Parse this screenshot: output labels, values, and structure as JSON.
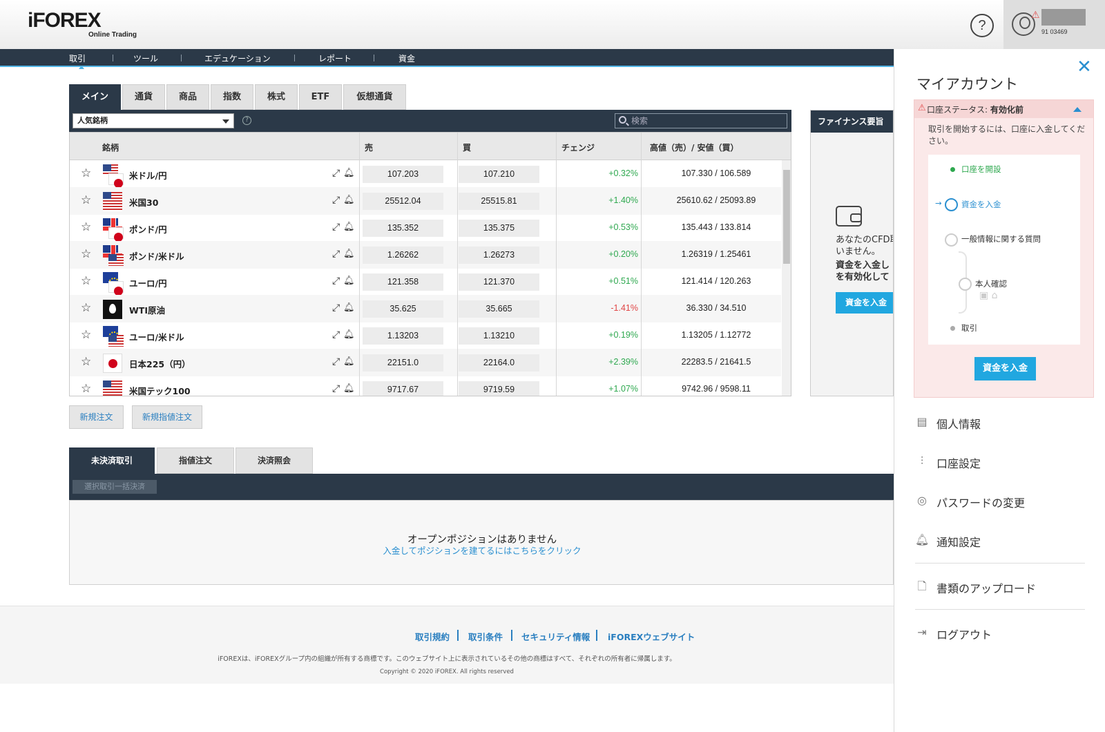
{
  "brand": {
    "name": "iFOREX",
    "tagline": "Online Trading"
  },
  "header": {
    "help_icon": "question-bubble-icon",
    "user_id": "91 03469"
  },
  "nav": [
    "取引",
    "ツール",
    "エデュケーション",
    "レポート",
    "資金"
  ],
  "asset_tabs": [
    "メイン",
    "通貨",
    "商品",
    "指数",
    "株式",
    "ETF",
    "仮想通貨"
  ],
  "filter": {
    "selected": "人気銘柄",
    "search_placeholder": "検索"
  },
  "table": {
    "headers": [
      "銘柄",
      "売",
      "買",
      "チェンジ",
      "高値（売）/ 安値（買）"
    ],
    "rows": [
      {
        "name": "米ドル/円",
        "sell": "107.203",
        "buy": "107.210",
        "change": "+0.32%",
        "dir": "up",
        "hl": "107.330 / 106.589",
        "flag": "us-jp"
      },
      {
        "name": "米国30",
        "sell": "25512.04",
        "buy": "25515.81",
        "change": "+1.40%",
        "dir": "up",
        "hl": "25610.62 / 25093.89",
        "flag": "us"
      },
      {
        "name": "ポンド/円",
        "sell": "135.352",
        "buy": "135.375",
        "change": "+0.53%",
        "dir": "up",
        "hl": "135.443 / 133.814",
        "flag": "uk-jp"
      },
      {
        "name": "ポンド/米ドル",
        "sell": "1.26262",
        "buy": "1.26273",
        "change": "+0.20%",
        "dir": "up",
        "hl": "1.26319 / 1.25461",
        "flag": "uk-us"
      },
      {
        "name": "ユーロ/円",
        "sell": "121.358",
        "buy": "121.370",
        "change": "+0.51%",
        "dir": "up",
        "hl": "121.414 / 120.263",
        "flag": "eu-jp"
      },
      {
        "name": "WTI原油",
        "sell": "35.625",
        "buy": "35.665",
        "change": "-1.41%",
        "dir": "down",
        "hl": "36.330 / 34.510",
        "flag": "oil"
      },
      {
        "name": "ユーロ/米ドル",
        "sell": "1.13203",
        "buy": "1.13210",
        "change": "+0.19%",
        "dir": "up",
        "hl": "1.13205 / 1.12772",
        "flag": "eu-us"
      },
      {
        "name": "日本225（円）",
        "sell": "22151.0",
        "buy": "22164.0",
        "change": "+2.39%",
        "dir": "up",
        "hl": "22283.5 / 21641.5",
        "flag": "jp"
      },
      {
        "name": "米国テック100",
        "sell": "9717.67",
        "buy": "9719.59",
        "change": "+1.07%",
        "dir": "up",
        "hl": "9742.96 / 9598.11",
        "flag": "us"
      }
    ]
  },
  "order_buttons": [
    "新規注文",
    "新規指値注文"
  ],
  "finance": {
    "title": "ファイナンス要旨",
    "text1a": "あなたのCFD取",
    "text1b": "いません。",
    "text2a": "資金を入金し",
    "text2b": "を有効化して",
    "button": "資金を入金"
  },
  "bottom_tabs": [
    "未決済取引",
    "指値注文",
    "決済照会"
  ],
  "bulk_close": "選択取引一括決済",
  "empty": {
    "title": "オープンポジションはありません",
    "link": "入金してポジションを建てるにはこちらをクリック"
  },
  "footer": {
    "links": [
      "取引規約",
      "取引条件",
      "セキュリティ情報",
      "iFOREXウェブサイト"
    ],
    "disclaimer": "iFOREXは、iFOREXグループ内の組織が所有する商標です。このウェブサイト上に表示されているその他の商標はすべて、それぞれの所有者に帰属します。",
    "copyright": "Copyright © 2020 iFOREX. All rights reserved"
  },
  "account": {
    "title": "マイアカウント",
    "status_label": "口座ステータス:",
    "status_value": "有効化前",
    "desc": "取引を開始するには、口座に入金してください。",
    "steps": [
      "口座を開設",
      "資金を入金",
      "一般情報に関する質問",
      "本人確認",
      "取引"
    ],
    "deposit_button": "資金を入金",
    "menu": [
      "個人情報",
      "口座設定",
      "パスワードの変更",
      "通知設定",
      "書類のアップロード",
      "ログアウト"
    ]
  },
  "colors": {
    "navy": "#2b3948",
    "accent": "#21a7e0",
    "up": "#2ea84f",
    "down": "#e04646"
  }
}
